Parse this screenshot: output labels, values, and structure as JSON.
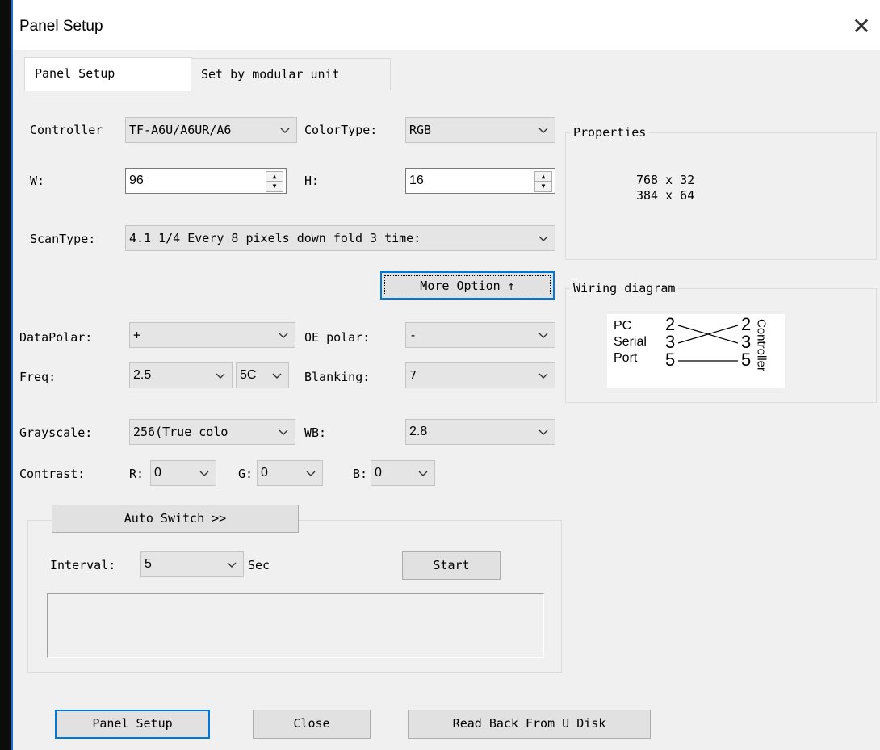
{
  "window": {
    "title": "Panel Setup",
    "close_glyph": "✕"
  },
  "tabs": [
    {
      "label": "Panel Setup"
    },
    {
      "label": "Set by modular unit"
    }
  ],
  "controller": {
    "label": "Controller",
    "value": "TF-A6U/A6UR/A6"
  },
  "color_type": {
    "label": "ColorType:",
    "value": "RGB"
  },
  "width": {
    "label": "W:",
    "value": "96"
  },
  "height": {
    "label": "H:",
    "value": "16"
  },
  "scan_type": {
    "label": "ScanType:",
    "value": "4.1  1/4 Every 8 pixels down fold 3 time:"
  },
  "properties": {
    "title": "Properties",
    "lines": [
      "768 x 32",
      "384 x 64"
    ]
  },
  "more_option": {
    "label": "More Option ↑"
  },
  "wiring": {
    "title": "Wiring diagram",
    "left_labels": [
      "PC",
      "Serial",
      "Port"
    ],
    "left_pins": [
      "2",
      "3",
      "5"
    ],
    "right_pins": [
      "2",
      "3",
      "5"
    ],
    "right_label": "Controller"
  },
  "data_polar": {
    "label": "DataPolar:",
    "value": "+"
  },
  "oe_polar": {
    "label": "OE polar:",
    "value": "-"
  },
  "freq": {
    "label": "Freq:",
    "value": "2.5",
    "value2": "5C"
  },
  "blanking": {
    "label": "Blanking:",
    "value": "7"
  },
  "grayscale": {
    "label": "Grayscale:",
    "value": "256(True colo"
  },
  "wb": {
    "label": "WB:",
    "value": "2.8"
  },
  "contrast": {
    "label": "Contrast:",
    "r_label": "R:",
    "r_value": "0",
    "g_label": "G:",
    "g_value": "0",
    "b_label": "B:",
    "b_value": "0"
  },
  "auto_switch": {
    "button": "Auto Switch >>",
    "interval_label": "Interval:",
    "interval_value": "5",
    "unit": "Sec",
    "start": "Start"
  },
  "footer": {
    "panel_setup": "Panel Setup",
    "close": "Close",
    "read_back": "Read Back From U Disk"
  }
}
